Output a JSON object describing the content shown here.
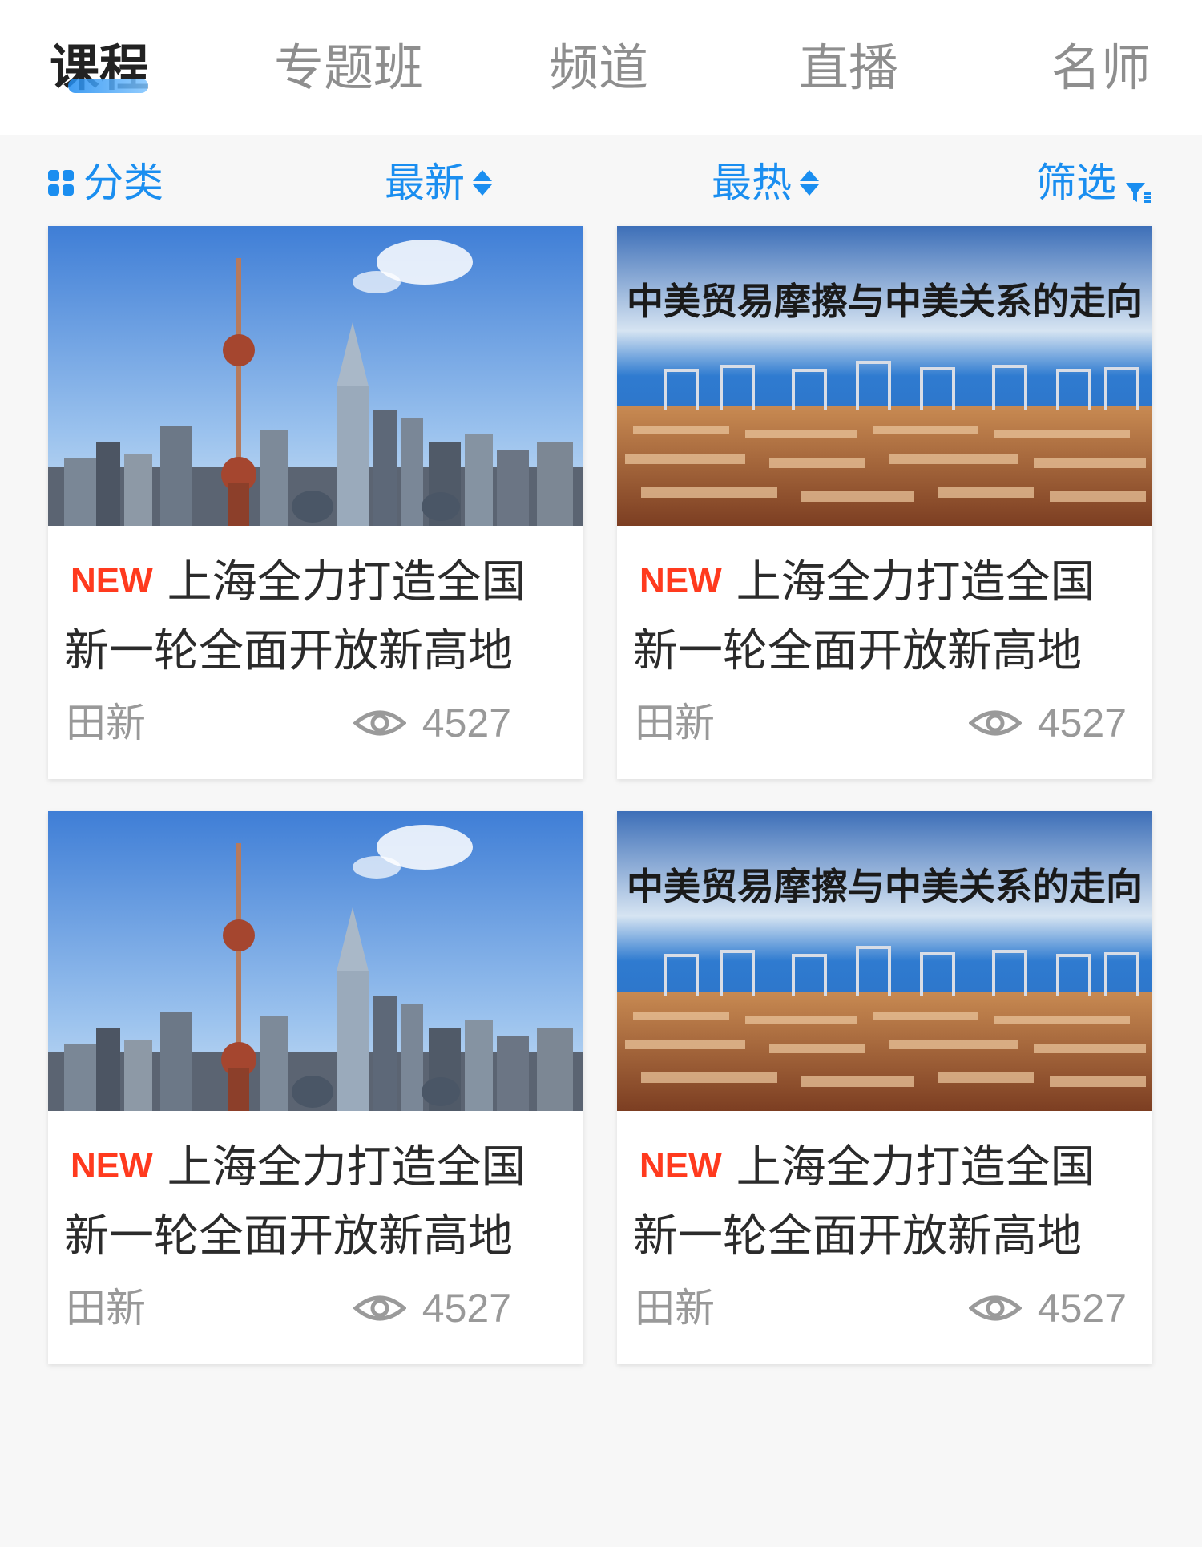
{
  "tabs": [
    {
      "label": "课程",
      "active": true
    },
    {
      "label": "专题班",
      "active": false
    },
    {
      "label": "频道",
      "active": false
    },
    {
      "label": "直播",
      "active": false
    },
    {
      "label": "名师",
      "active": false
    }
  ],
  "filters": {
    "category": "分类",
    "latest": "最新",
    "hottest": "最热",
    "filter": "筛选"
  },
  "accent_color": "#1a8ef0",
  "new_badge_color": "#ff3a1e",
  "courses": [
    {
      "badge": "NEW",
      "title": "上海全力打造全国新一轮全面开放新高地",
      "author": "田新",
      "views": "4527",
      "image": "shanghai-skyline"
    },
    {
      "badge": "NEW",
      "title": "上海全力打造全国新一轮全面开放新高地",
      "author": "田新",
      "views": "4527",
      "image": "container-port",
      "image_caption": "中美贸易摩擦与中美关系的走向"
    },
    {
      "badge": "NEW",
      "title": "上海全力打造全国新一轮全面开放新高地",
      "author": "田新",
      "views": "4527",
      "image": "shanghai-skyline"
    },
    {
      "badge": "NEW",
      "title": "上海全力打造全国新一轮全面开放新高地",
      "author": "田新",
      "views": "4527",
      "image": "container-port",
      "image_caption": "中美贸易摩擦与中美关系的走向"
    }
  ]
}
